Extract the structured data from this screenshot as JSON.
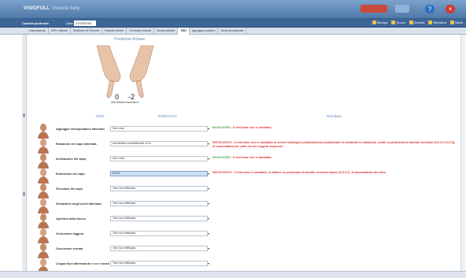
{
  "app": {
    "title": "VISIOFULL",
    "subtitle": "Visione  help"
  },
  "toolbar": {
    "section_label": "Cartella posturale",
    "date_label": "Data",
    "date_value": "27/03/2016",
    "actions": [
      {
        "label": "Stampa",
        "icon": "printer-icon"
      },
      {
        "label": "Nuovo",
        "icon": "new-icon"
      },
      {
        "label": "Annulla",
        "icon": "undo-icon"
      },
      {
        "label": "Ripristina",
        "icon": "restore-icon"
      },
      {
        "label": "Salva",
        "icon": "save-icon"
      }
    ]
  },
  "tabs": [
    {
      "label": "Dati posturali"
    },
    {
      "label": "ATP e Bambi"
    },
    {
      "label": "Sindrome di Fulcrum"
    },
    {
      "label": "Rachide dolore"
    },
    {
      "label": "Cervicale testicoli"
    },
    {
      "label": "Oculomotricità"
    },
    {
      "label": "TMD"
    },
    {
      "label": "Appoggio podalico"
    },
    {
      "label": "Schema posturale"
    }
  ],
  "active_tab": 6,
  "panel": {
    "position_title": "Posizione di base",
    "left_value": "0",
    "right_value": "-2",
    "neck_select": "Alla destra avanzata"
  },
  "columns": {
    "test": "TEST",
    "response": "RISPOSTA",
    "result": "Risultato"
  },
  "rows": [
    {
      "name": "Appoggio monopodalico alternato",
      "response": "Non nota",
      "selected": false,
      "result_tag": "INVOLUCRO",
      "result_text": " - Il test base non è cambiato",
      "style": "green"
    },
    {
      "name": "Rotazione del capo alternata",
      "response": "Aumentato contralaterale a Dx",
      "selected": false,
      "result_tag": "PATOLOGICO",
      "result_text": " - Il test base non è cambiato in senso fisiologico (cambiamento omolaterale in entrambe le rotazioni), esiste un problema di rachide cervicale (C0-C1-C2-C3), di muscolatura del collo e/o del cingolo superiore",
      "style": "red"
    },
    {
      "name": "Inclinazione del capo",
      "response": "Non nota",
      "selected": false,
      "result_tag": "INVOLUCRO",
      "result_text": " - Il test base non è cambiato",
      "style": "green"
    },
    {
      "name": "Estensione del capo",
      "response": "Dx/Sx",
      "selected": true,
      "result_tag": "PATOLOGICO",
      "result_text": " - Il test base è cambiato, si ottiene un problema di rachide cervicale basso (C3-C7), di muscolatura del collo",
      "style": "red"
    },
    {
      "name": "Flessione del capo",
      "response": "Test non effettuato",
      "selected": false,
      "result_tag": "",
      "result_text": "",
      "style": "none"
    },
    {
      "name": "Deviazione degli occhi alternata",
      "response": "Test non effettuato",
      "selected": false,
      "result_tag": "",
      "result_text": "",
      "style": "none"
    },
    {
      "name": "Apertura della bocca",
      "response": "Test non effettuato",
      "selected": false,
      "result_tag": "",
      "result_text": "",
      "style": "none"
    },
    {
      "name": "Occlusione leggera",
      "response": "Test non effettuato",
      "selected": false,
      "result_tag": "",
      "result_text": "",
      "style": "none"
    },
    {
      "name": "Occlusione serrata",
      "response": "Test non effettuato",
      "selected": false,
      "result_tag": "",
      "result_text": "",
      "style": "none"
    },
    {
      "name": "Lingua fuori alternata dx e sx e vocali",
      "response": "Test non effettuato",
      "selected": false,
      "result_tag": "",
      "result_text": "",
      "style": "none"
    }
  ],
  "colors": {
    "accent": "#5a84b8",
    "pathological": "#e0322a",
    "neutral_ok": "#3aa53a",
    "titlebar": "#4f79a8"
  }
}
